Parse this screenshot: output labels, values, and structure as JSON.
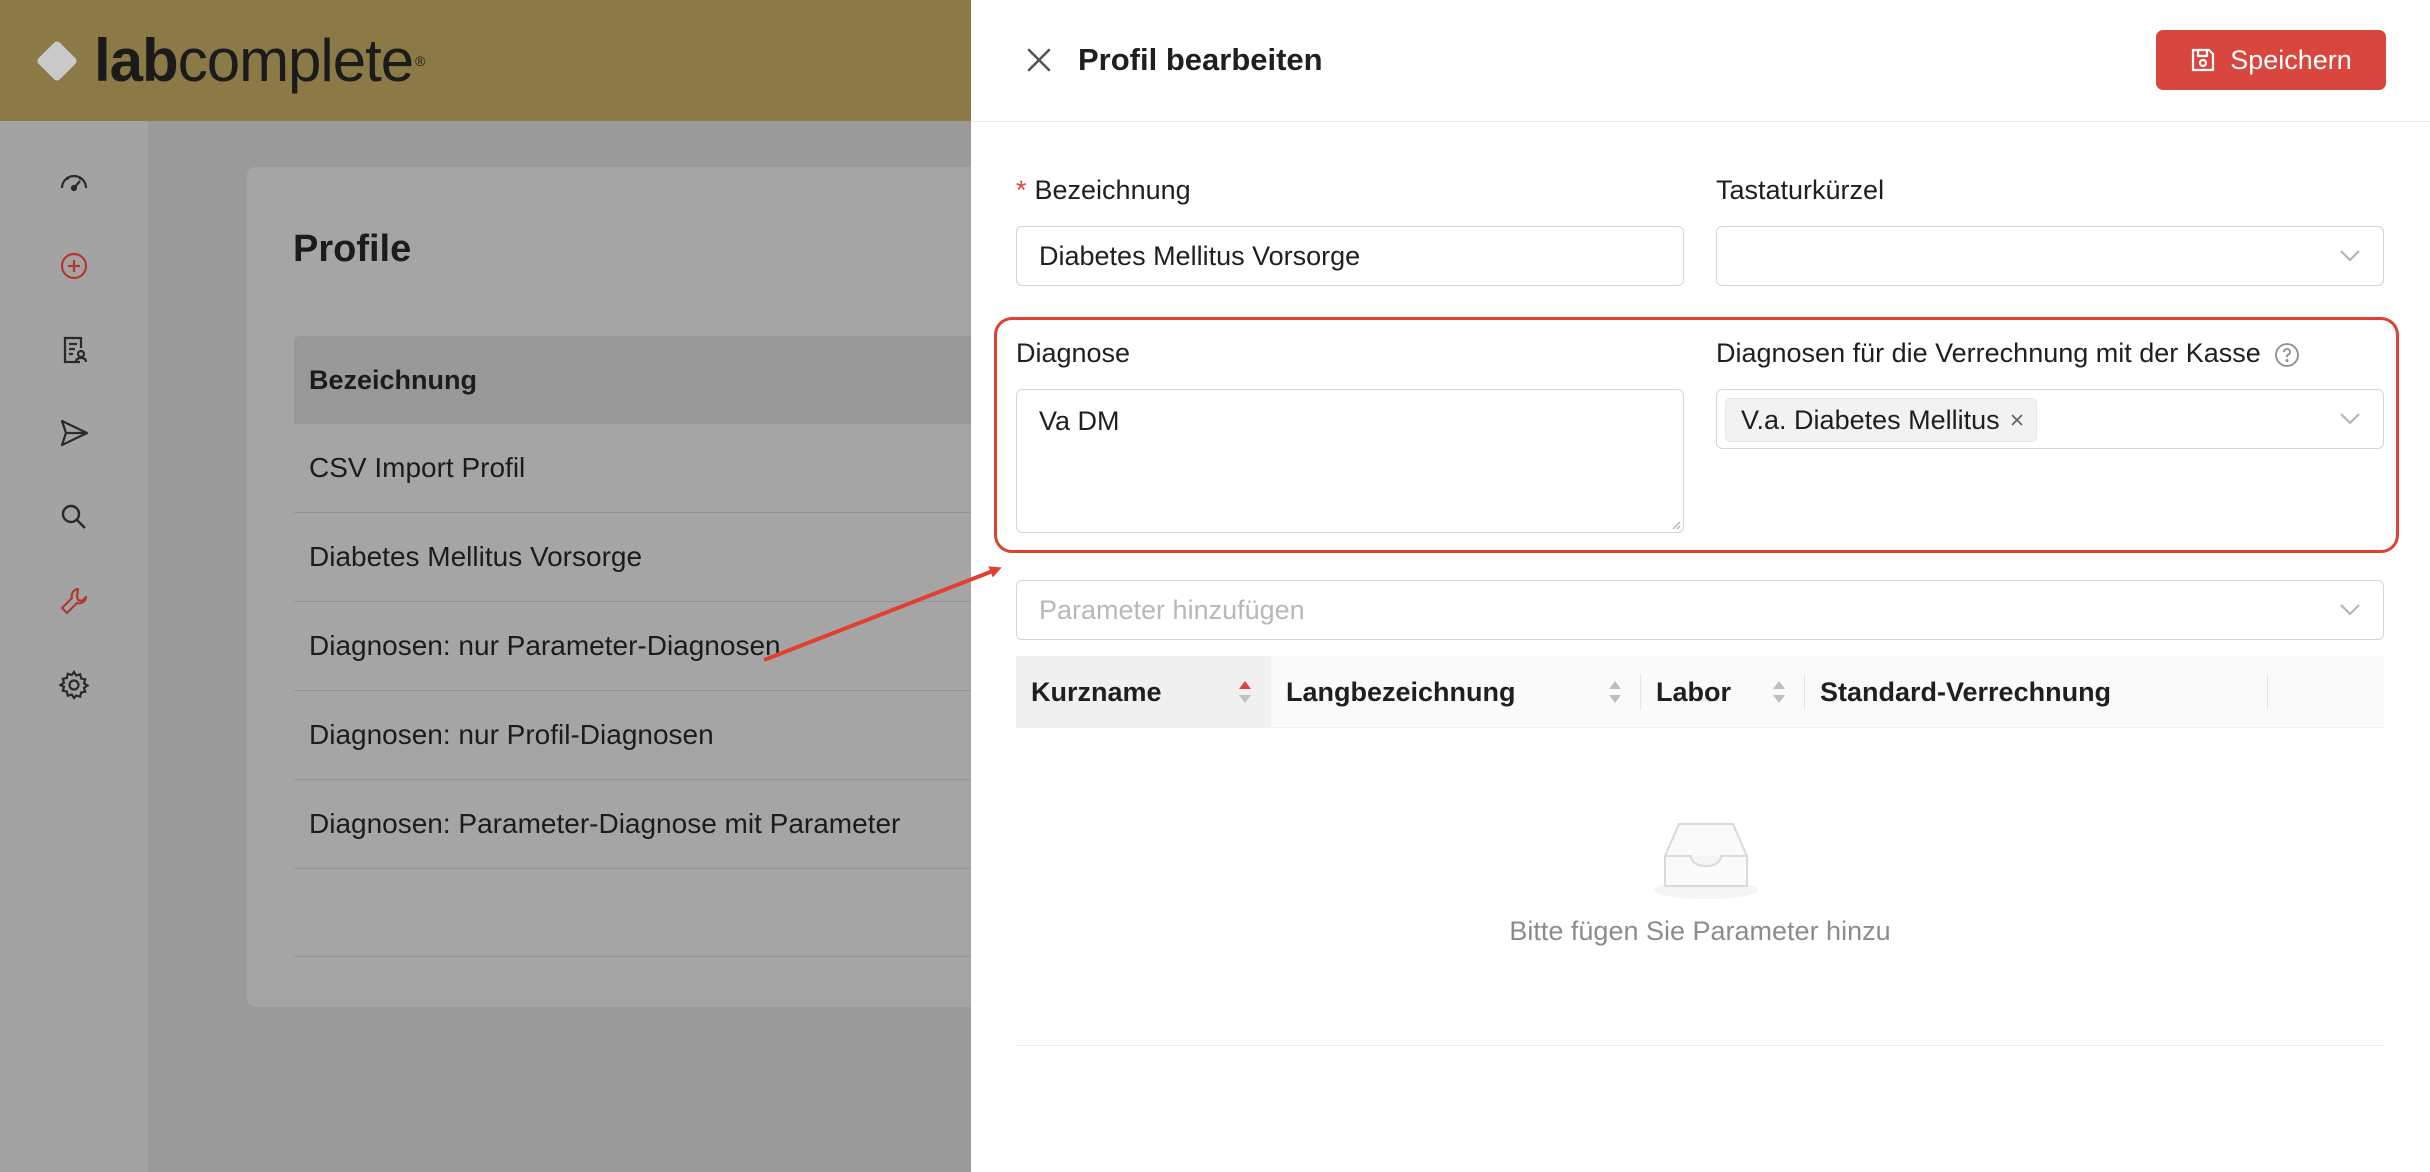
{
  "app": {
    "logo": {
      "prefix": "lab",
      "suffix": "complete",
      "mark": "®"
    }
  },
  "sidebar": {
    "items": [
      {
        "icon": "dashboard-icon"
      },
      {
        "icon": "add-circle-icon"
      },
      {
        "icon": "report-icon"
      },
      {
        "icon": "send-icon"
      },
      {
        "icon": "search-icon"
      },
      {
        "icon": "wrench-icon"
      },
      {
        "icon": "gear-icon"
      }
    ]
  },
  "page": {
    "title": "Profile",
    "table": {
      "header": "Bezeichnung",
      "rows": [
        "CSV Import Profil",
        "Diabetes Mellitus Vorsorge",
        "Diagnosen: nur Parameter-Diagnosen",
        "Diagnosen: nur Profil-Diagnosen",
        "Diagnosen: Parameter-Diagnose mit Parameter"
      ]
    }
  },
  "drawer": {
    "title": "Profil bearbeiten",
    "save_label": "Speichern",
    "fields": {
      "bezeichnung_label": "Bezeichnung",
      "bezeichnung_value": "Diabetes Mellitus Vorsorge",
      "shortcut_label": "Tastaturkürzel",
      "shortcut_value": "",
      "diagnose_label": "Diagnose",
      "diagnose_value": "Va DM",
      "billing_label": "Diagnosen für die Verrechnung mit der Kasse",
      "billing_tags": [
        "V.a. Diabetes Mellitus"
      ],
      "param_placeholder": "Parameter hinzufügen"
    },
    "param_table": {
      "columns": [
        "Kurzname",
        "Langbezeichnung",
        "Labor",
        "Standard-Verrechnung"
      ],
      "empty_text": "Bitte fügen Sie Parameter hinzu"
    }
  },
  "colors": {
    "topbar": "#8b7a45",
    "accent": "#d9463d",
    "highlight": "#e0402f"
  }
}
